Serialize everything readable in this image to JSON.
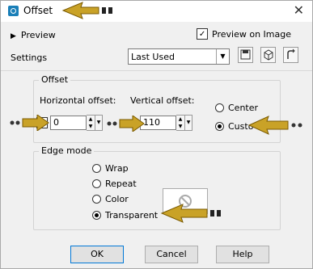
{
  "window": {
    "title": "Offset",
    "close_glyph": "✕"
  },
  "preview": {
    "toggle_label": "Preview",
    "check_label": "Preview on Image",
    "checked": true
  },
  "settings": {
    "label": "Settings",
    "selected": "Last Used"
  },
  "offset_group": {
    "title": "Offset",
    "horizontal_label": "Horizontal offset:",
    "horizontal_value": "0",
    "vertical_label": "Vertical offset:",
    "vertical_value": "110",
    "center_label": "Center",
    "custom_label": "Custo"
  },
  "edge_group": {
    "title": "Edge mode",
    "options": [
      "Wrap",
      "Repeat",
      "Color",
      "Transparent"
    ],
    "selected": "Transparent"
  },
  "buttons": {
    "ok": "OK",
    "cancel": "Cancel",
    "help": "Help"
  },
  "icons": [
    "camera-icon",
    "save-icon",
    "cube-icon",
    "reset-icon",
    "no-color-icon",
    "arrow-pointer-icon"
  ]
}
